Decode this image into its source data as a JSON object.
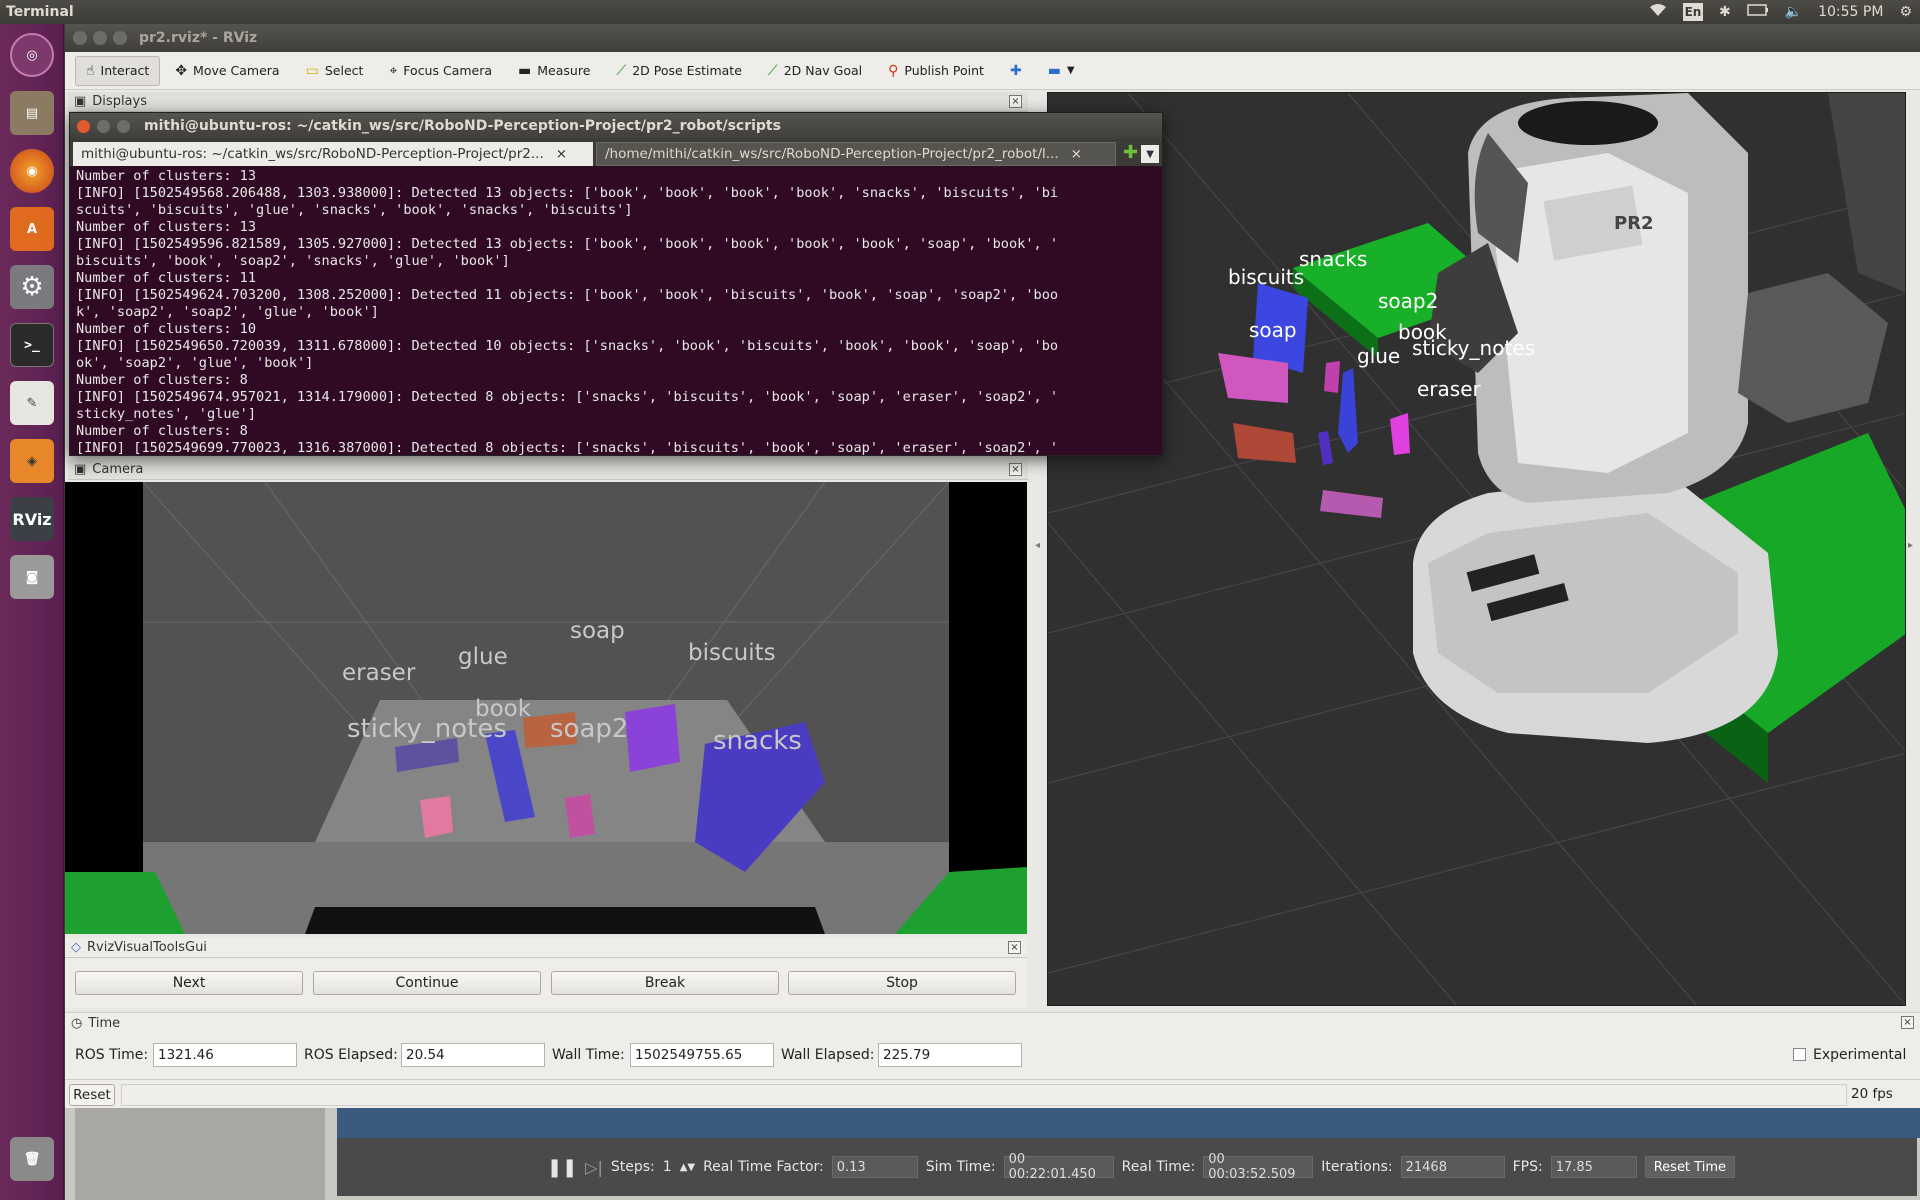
{
  "top_panel": {
    "app_name": "Terminal",
    "keyboard": "En",
    "clock": "10:55 PM"
  },
  "launcher": {
    "items": [
      {
        "name": "ubuntu-dash"
      },
      {
        "name": "files"
      },
      {
        "name": "firefox"
      },
      {
        "name": "software-center"
      },
      {
        "name": "system-settings"
      },
      {
        "name": "terminal"
      },
      {
        "name": "text-editor"
      },
      {
        "name": "gazebo"
      },
      {
        "name": "rviz",
        "label": "RViz"
      },
      {
        "name": "screenshot"
      },
      {
        "name": "trash"
      }
    ]
  },
  "rviz": {
    "window_title": "pr2.rviz* - RViz",
    "toolbar": {
      "interact": "Interact",
      "move_camera": "Move Camera",
      "select": "Select",
      "focus_camera": "Focus Camera",
      "measure": "Measure",
      "pose_estimate": "2D Pose Estimate",
      "nav_goal": "2D Nav Goal",
      "publish_point": "Publish Point"
    },
    "displays_title": "Displays",
    "camera_title": "Camera",
    "visual_tools_title": "RvizVisualToolsGui",
    "buttons": {
      "next": "Next",
      "continue": "Continue",
      "break": "Break",
      "stop": "Stop"
    },
    "time": {
      "title": "Time",
      "ros_time_label": "ROS Time:",
      "ros_time": "1321.46",
      "ros_elapsed_label": "ROS Elapsed:",
      "ros_elapsed": "20.54",
      "wall_time_label": "Wall Time:",
      "wall_time": "1502549755.65",
      "wall_elapsed_label": "Wall Elapsed:",
      "wall_elapsed": "225.79",
      "experimental": "Experimental",
      "reset": "Reset",
      "fps": "20 fps"
    },
    "view3d_labels": {
      "snacks": "snacks",
      "biscuits": "biscuits",
      "soap2": "soap2",
      "soap": "soap",
      "book": "book",
      "glue": "glue",
      "sticky_notes": "sticky_notes",
      "eraser": "eraser",
      "pr2_badge": "PR2"
    },
    "camera_labels": {
      "soap": "soap",
      "eraser": "eraser",
      "glue": "glue",
      "biscuits": "biscuits",
      "book": "book",
      "sticky_notes": "sticky_notes",
      "soap2": "soap2",
      "snacks": "snacks"
    }
  },
  "gazebo": {
    "steps_label": "Steps:",
    "steps_value": "1",
    "rtf_label": "Real Time Factor:",
    "rtf_value": "0.13",
    "sim_time_label": "Sim Time:",
    "sim_time_value": "00 00:22:01.450",
    "real_time_label": "Real Time:",
    "real_time_value": "00 00:03:52.509",
    "iterations_label": "Iterations:",
    "iterations_value": "21468",
    "fps_label": "FPS:",
    "fps_value": "17.85",
    "reset_time": "Reset Time"
  },
  "terminal": {
    "title": "mithi@ubuntu-ros: ~/catkin_ws/src/RoboND-Perception-Project/pr2_robot/scripts",
    "tab1": "mithi@ubuntu-ros: ~/catkin_ws/src/RoboND-Perception-Project/pr2...",
    "tab2": "/home/mithi/catkin_ws/src/RoboND-Perception-Project/pr2_robot/l...",
    "lines": [
      "Number of clusters: 13",
      "[INFO] [1502549568.206488, 1303.938000]: Detected 13 objects: ['book', 'book', 'book', 'book', 'snacks', 'biscuits', 'bi",
      "scuits', 'biscuits', 'glue', 'snacks', 'book', 'snacks', 'biscuits']",
      "Number of clusters: 13",
      "[INFO] [1502549596.821589, 1305.927000]: Detected 13 objects: ['book', 'book', 'book', 'book', 'book', 'soap', 'book', '",
      "biscuits', 'book', 'soap2', 'snacks', 'glue', 'book']",
      "Number of clusters: 11",
      "[INFO] [1502549624.703200, 1308.252000]: Detected 11 objects: ['book', 'book', 'biscuits', 'book', 'soap', 'soap2', 'boo",
      "k', 'soap2', 'soap2', 'glue', 'book']",
      "Number of clusters: 10",
      "[INFO] [1502549650.720039, 1311.678000]: Detected 10 objects: ['snacks', 'book', 'biscuits', 'book', 'book', 'soap', 'bo",
      "ok', 'soap2', 'glue', 'book']",
      "Number of clusters: 8",
      "[INFO] [1502549674.957021, 1314.179000]: Detected 8 objects: ['snacks', 'biscuits', 'book', 'soap', 'eraser', 'soap2', '",
      "sticky_notes', 'glue']",
      "Number of clusters: 8",
      "[INFO] [1502549699.770023, 1316.387000]: Detected 8 objects: ['snacks', 'biscuits', 'book', 'soap', 'eraser', 'soap2', '"
    ]
  }
}
